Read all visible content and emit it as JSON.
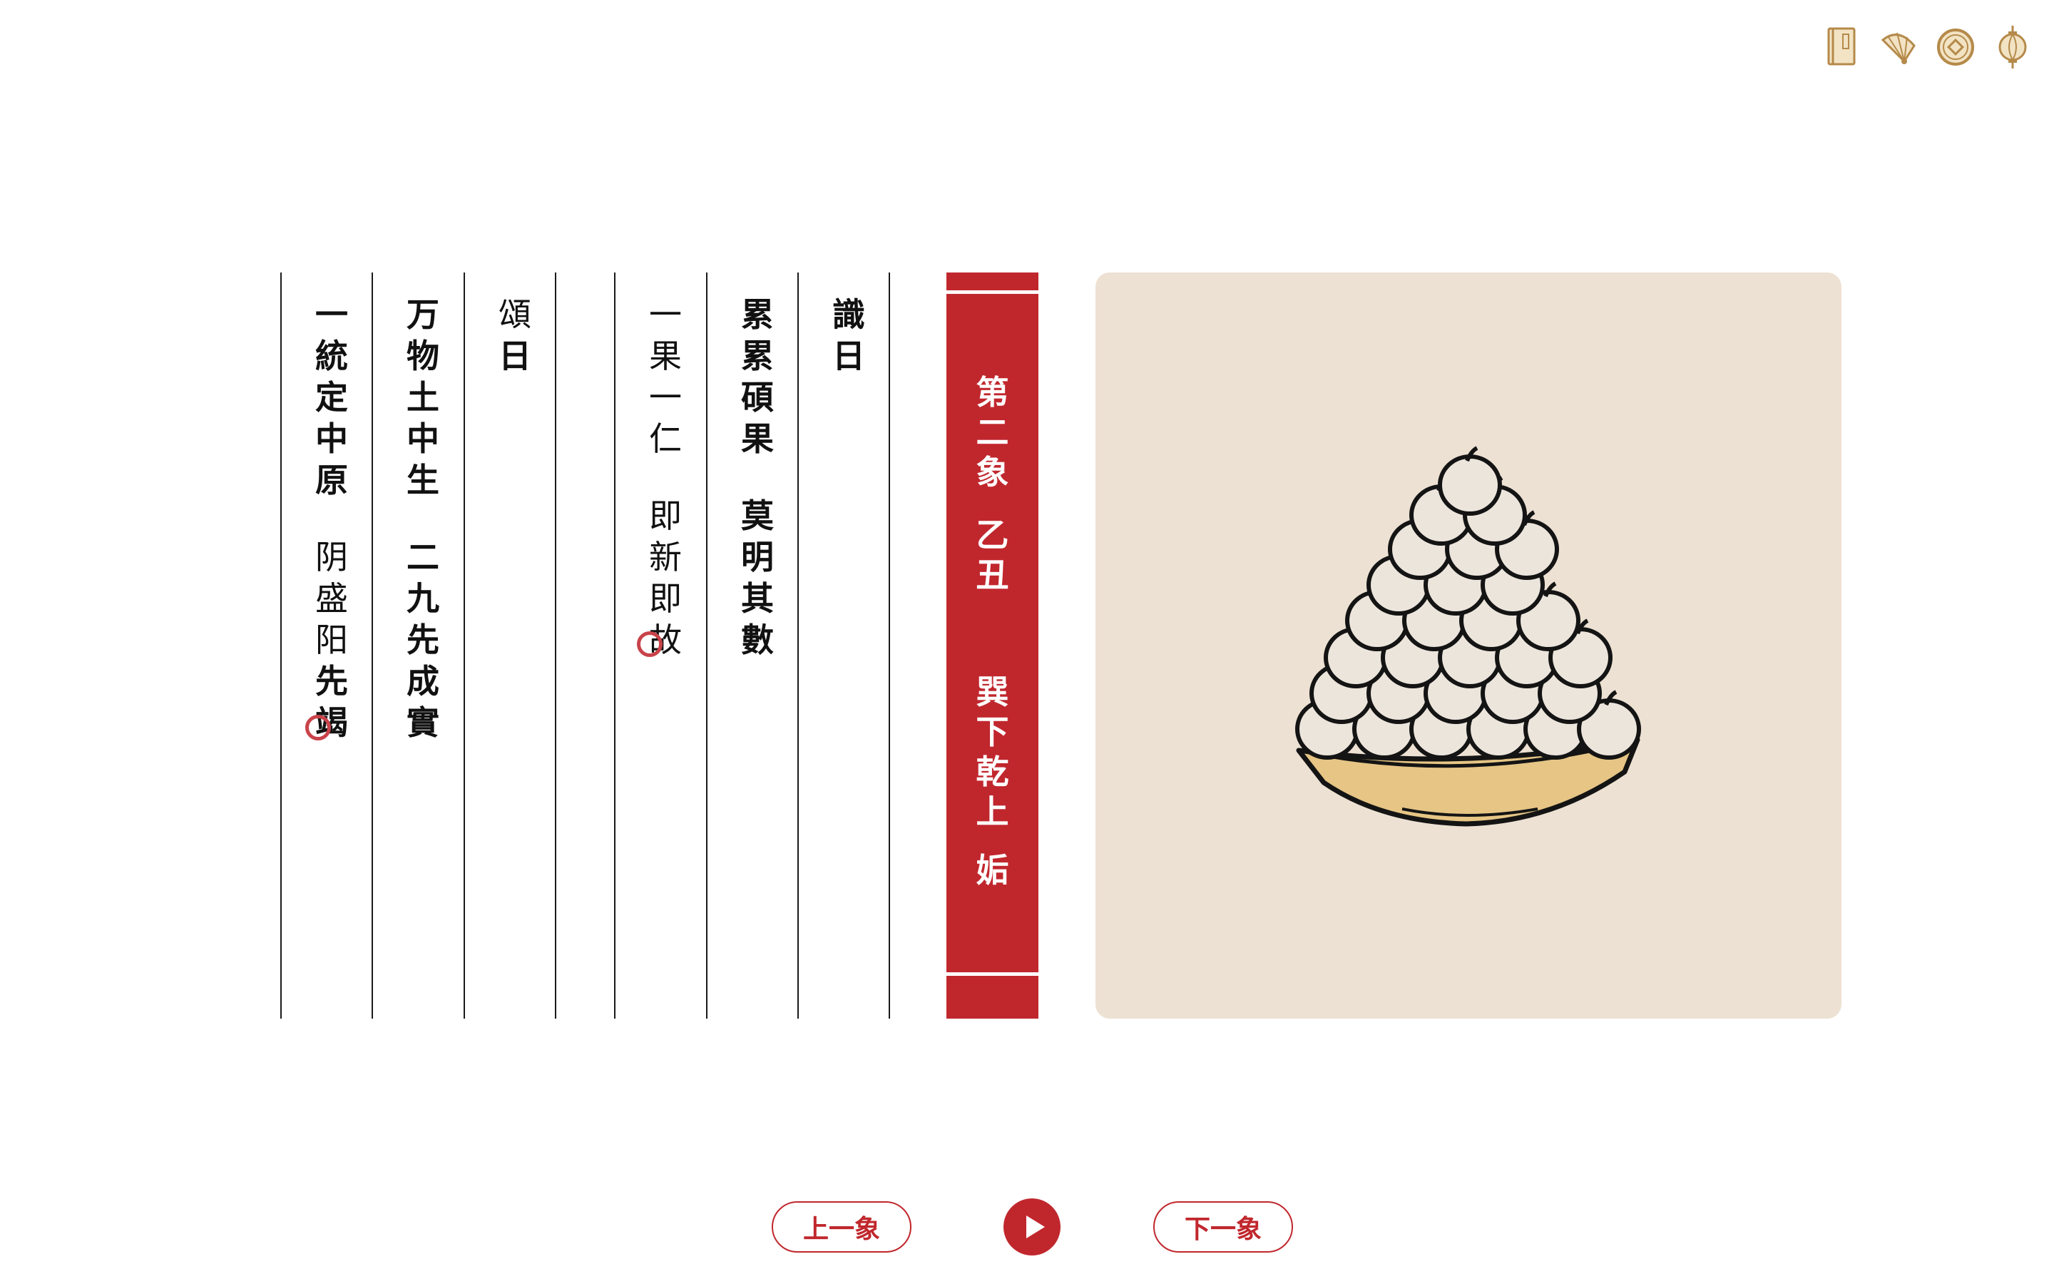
{
  "toolbar": {
    "icons": [
      "book-icon",
      "fan-icon",
      "coin-icon",
      "lantern-icon"
    ]
  },
  "columns": [
    {
      "id": "c1",
      "chars": [
        "識",
        "日"
      ],
      "weight": "bold"
    },
    {
      "id": "c2",
      "chars": [
        "累",
        "累",
        "碩",
        "果",
        " ",
        "莫",
        "明",
        "其",
        "數"
      ],
      "weight": "bold"
    },
    {
      "id": "c3",
      "chars": [
        "一",
        "果",
        "一",
        "仁",
        " ",
        "即",
        "新",
        "即",
        "故"
      ],
      "weight": "bold"
    },
    {
      "id": "c4",
      "chars": [
        "頌",
        "日"
      ],
      "weight": "bold"
    },
    {
      "id": "c5",
      "chars": [
        "万",
        "物",
        "土",
        "中",
        "生",
        " ",
        "二",
        "九",
        "先",
        "成",
        "實"
      ],
      "weight": "bold"
    },
    {
      "id": "c6",
      "chars": [
        "一",
        "統",
        "定",
        "中",
        "原",
        " ",
        "阴",
        "盛",
        "阳",
        "先",
        "竭"
      ],
      "weight": "bold"
    }
  ],
  "spine": {
    "title_chars": [
      "第",
      "二",
      "象"
    ],
    "ganzhi_chars": [
      "乙",
      "丑"
    ],
    "gua_chars": [
      "巽",
      "下",
      "乾",
      "上"
    ],
    "gua_name": "姤"
  },
  "nav": {
    "prev_label": "上一象",
    "next_label": "下一象",
    "play_icon": "play-icon"
  },
  "colors": {
    "accent_red": "#c0272d",
    "panel_bg": "#ede1d3",
    "plate": "#e6c585",
    "icon_gold": "#b58a4a"
  }
}
